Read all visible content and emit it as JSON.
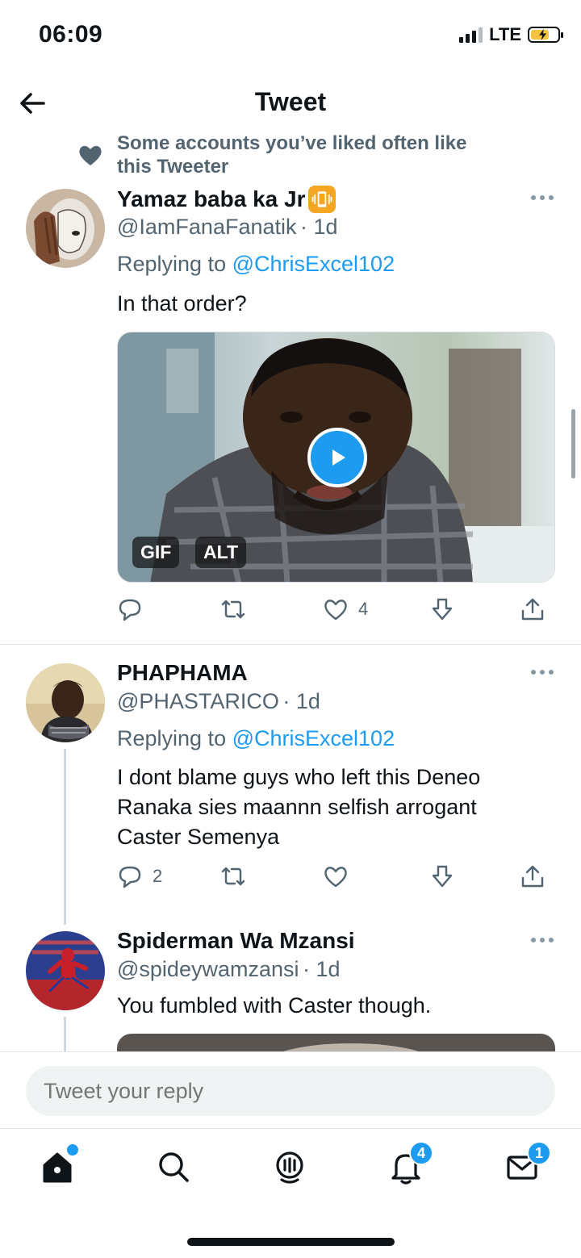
{
  "status_bar": {
    "time": "06:09",
    "network": "LTE"
  },
  "header": {
    "title": "Tweet"
  },
  "social_context": {
    "text": "Some accounts you’ve liked often like this Tweeter"
  },
  "tweets": [
    {
      "name": "Yamaz baba ka Jr",
      "name_emoji": "📳",
      "handle": "@IamFanaFanatik",
      "time": "· 1d",
      "replying_prefix": "Replying to",
      "replying_to": "@ChrisExcel102",
      "text": "In that order?",
      "media": {
        "badges": [
          "GIF",
          "ALT"
        ]
      },
      "actions": {
        "replies": "",
        "retweets": "",
        "likes": "4"
      }
    },
    {
      "name": "PHAPHAMA",
      "handle": "@PHASTARICO",
      "time": "· 1d",
      "replying_prefix": "Replying to",
      "replying_to": "@ChrisExcel102",
      "text": "I dont blame guys who left this Deneo Ranaka sies maannn selfish arrogant Caster Semenya",
      "actions": {
        "replies": "2",
        "retweets": "",
        "likes": ""
      }
    },
    {
      "name": "Spiderman Wa Mzansi",
      "handle": "@spideywamzansi",
      "time": "· 1d",
      "text": "You fumbled with Caster though."
    }
  ],
  "reply_bar": {
    "placeholder": "Tweet your reply"
  },
  "tab_bar": {
    "items": [
      "home-icon",
      "search-icon",
      "spaces-icon",
      "notifications-icon",
      "messages-icon"
    ],
    "notifications_badge": "4",
    "messages_badge": "1"
  },
  "colors": {
    "accent": "#1d9bf0",
    "secondary_text": "#536471"
  }
}
